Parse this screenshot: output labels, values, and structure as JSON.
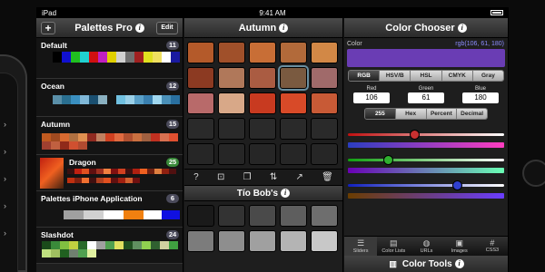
{
  "status": {
    "carrier": "iPad",
    "time": "9:41 AM"
  },
  "palettes": {
    "title": "Palettes Pro",
    "edit_label": "Edit",
    "add_label": "+",
    "items": [
      {
        "name": "Default",
        "count": "11"
      },
      {
        "name": "Ocean",
        "count": "12"
      },
      {
        "name": "Autumn",
        "count": "15"
      },
      {
        "name": "Dragon",
        "count": "25"
      },
      {
        "name": "Palettes iPhone Application",
        "count": "6"
      },
      {
        "name": "Slashdot",
        "count": "24"
      }
    ]
  },
  "colors": {
    "autumn_title": "Autumn",
    "second_title": "Tío Bob's"
  },
  "chooser": {
    "title": "Color Chooser",
    "color_label": "Color",
    "rgb_text": "rgb(106, 61, 180)",
    "modes": [
      "RGB",
      "HSV/B",
      "HSL",
      "CMYK",
      "Gray"
    ],
    "active_mode": "RGB",
    "fields": [
      {
        "label": "Red",
        "value": "106"
      },
      {
        "label": "Green",
        "value": "61"
      },
      {
        "label": "Blue",
        "value": "180"
      }
    ],
    "formats": [
      "255",
      "Hex",
      "Percent",
      "Decimal"
    ],
    "active_format": "255",
    "tabs": [
      "Sliders",
      "Color Lists",
      "URLs",
      "Images",
      "CSS3"
    ],
    "active_tab": "Sliders",
    "tools_title": "Color Tools",
    "swatch_color": "#6a3db4",
    "slider_levels": {
      "red": 0.42,
      "green": 0.24,
      "blue": 0.71
    }
  }
}
